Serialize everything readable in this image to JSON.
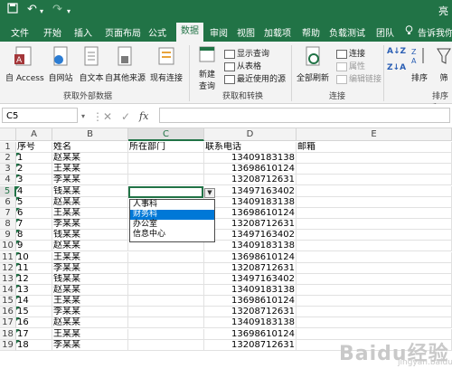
{
  "window": {
    "title": "亮"
  },
  "menu": {
    "tabs": [
      "文件",
      "开始",
      "插入",
      "页面布局",
      "公式",
      "数据",
      "审阅",
      "视图",
      "加载项",
      "帮助",
      "负载测试",
      "团队"
    ],
    "active": "数据",
    "tell_me": "告诉我你"
  },
  "ribbon": {
    "access": "自 Access",
    "web": "自网站",
    "text": "自文本",
    "other": "自其他来源",
    "existing": "现有连接",
    "group_external": "获取外部数据",
    "new_query": "新建",
    "new_query2": "查询",
    "show_query": "显示查询",
    "from_table": "从表格",
    "recent": "最近使用的源",
    "group_transform": "获取和转换",
    "refresh_all": "全部刷新",
    "connections": "连接",
    "properties": "属性",
    "edit_links": "编辑链接",
    "group_connections": "连接",
    "sort_az": "A↓Z",
    "sort_za": "Z↓A",
    "sort": "排序",
    "filter": "筛",
    "group_sort": "排序和"
  },
  "formula_bar": {
    "name_box": "C5",
    "cancel": "✕",
    "enter": "✓",
    "fx": "fx",
    "content": ""
  },
  "grid": {
    "columns": [
      "A",
      "B",
      "C",
      "D",
      "E"
    ],
    "selected_column": "C",
    "selected_row": 5,
    "rows": [
      {
        "n": "1",
        "a": "序号",
        "b": "姓名",
        "c": "所在部门",
        "d": "联系电话",
        "e": "邮箱"
      },
      {
        "n": "2",
        "a": "1",
        "b": "赵某某",
        "c": "",
        "d": "13409183138",
        "e": ""
      },
      {
        "n": "3",
        "a": "2",
        "b": "王某某",
        "c": "",
        "d": "13698610124",
        "e": ""
      },
      {
        "n": "4",
        "a": "3",
        "b": "李某某",
        "c": "",
        "d": "13208712631",
        "e": ""
      },
      {
        "n": "5",
        "a": "4",
        "b": "钱某某",
        "c": "",
        "d": "13497163402",
        "e": ""
      },
      {
        "n": "6",
        "a": "5",
        "b": "赵某某",
        "c": "",
        "d": "13409183138",
        "e": ""
      },
      {
        "n": "7",
        "a": "6",
        "b": "王某某",
        "c": "",
        "d": "13698610124",
        "e": ""
      },
      {
        "n": "8",
        "a": "7",
        "b": "李某某",
        "c": "",
        "d": "13208712631",
        "e": ""
      },
      {
        "n": "9",
        "a": "8",
        "b": "钱某某",
        "c": "",
        "d": "13497163402",
        "e": ""
      },
      {
        "n": "10",
        "a": "9",
        "b": "赵某某",
        "c": "",
        "d": "13409183138",
        "e": ""
      },
      {
        "n": "11",
        "a": "10",
        "b": "王某某",
        "c": "",
        "d": "13698610124",
        "e": ""
      },
      {
        "n": "12",
        "a": "11",
        "b": "李某某",
        "c": "",
        "d": "13208712631",
        "e": ""
      },
      {
        "n": "13",
        "a": "12",
        "b": "钱某某",
        "c": "",
        "d": "13497163402",
        "e": ""
      },
      {
        "n": "14",
        "a": "13",
        "b": "赵某某",
        "c": "",
        "d": "13409183138",
        "e": ""
      },
      {
        "n": "15",
        "a": "14",
        "b": "王某某",
        "c": "",
        "d": "13698610124",
        "e": ""
      },
      {
        "n": "16",
        "a": "15",
        "b": "李某某",
        "c": "",
        "d": "13208712631",
        "e": ""
      },
      {
        "n": "17",
        "a": "16",
        "b": "赵某某",
        "c": "",
        "d": "13409183138",
        "e": ""
      },
      {
        "n": "18",
        "a": "17",
        "b": "王某某",
        "c": "",
        "d": "13698610124",
        "e": ""
      },
      {
        "n": "19",
        "a": "18",
        "b": "李某某",
        "c": "",
        "d": "13208712631",
        "e": ""
      }
    ]
  },
  "dropdown": {
    "options": [
      "人事科",
      "财务科",
      "办公室",
      "信息中心"
    ],
    "highlighted": "财务科"
  },
  "watermark": "Baidu经验",
  "watermark_sub": "jingyan.baidu.com",
  "colors": {
    "excel_green": "#217346",
    "highlight": "#0078d7"
  }
}
